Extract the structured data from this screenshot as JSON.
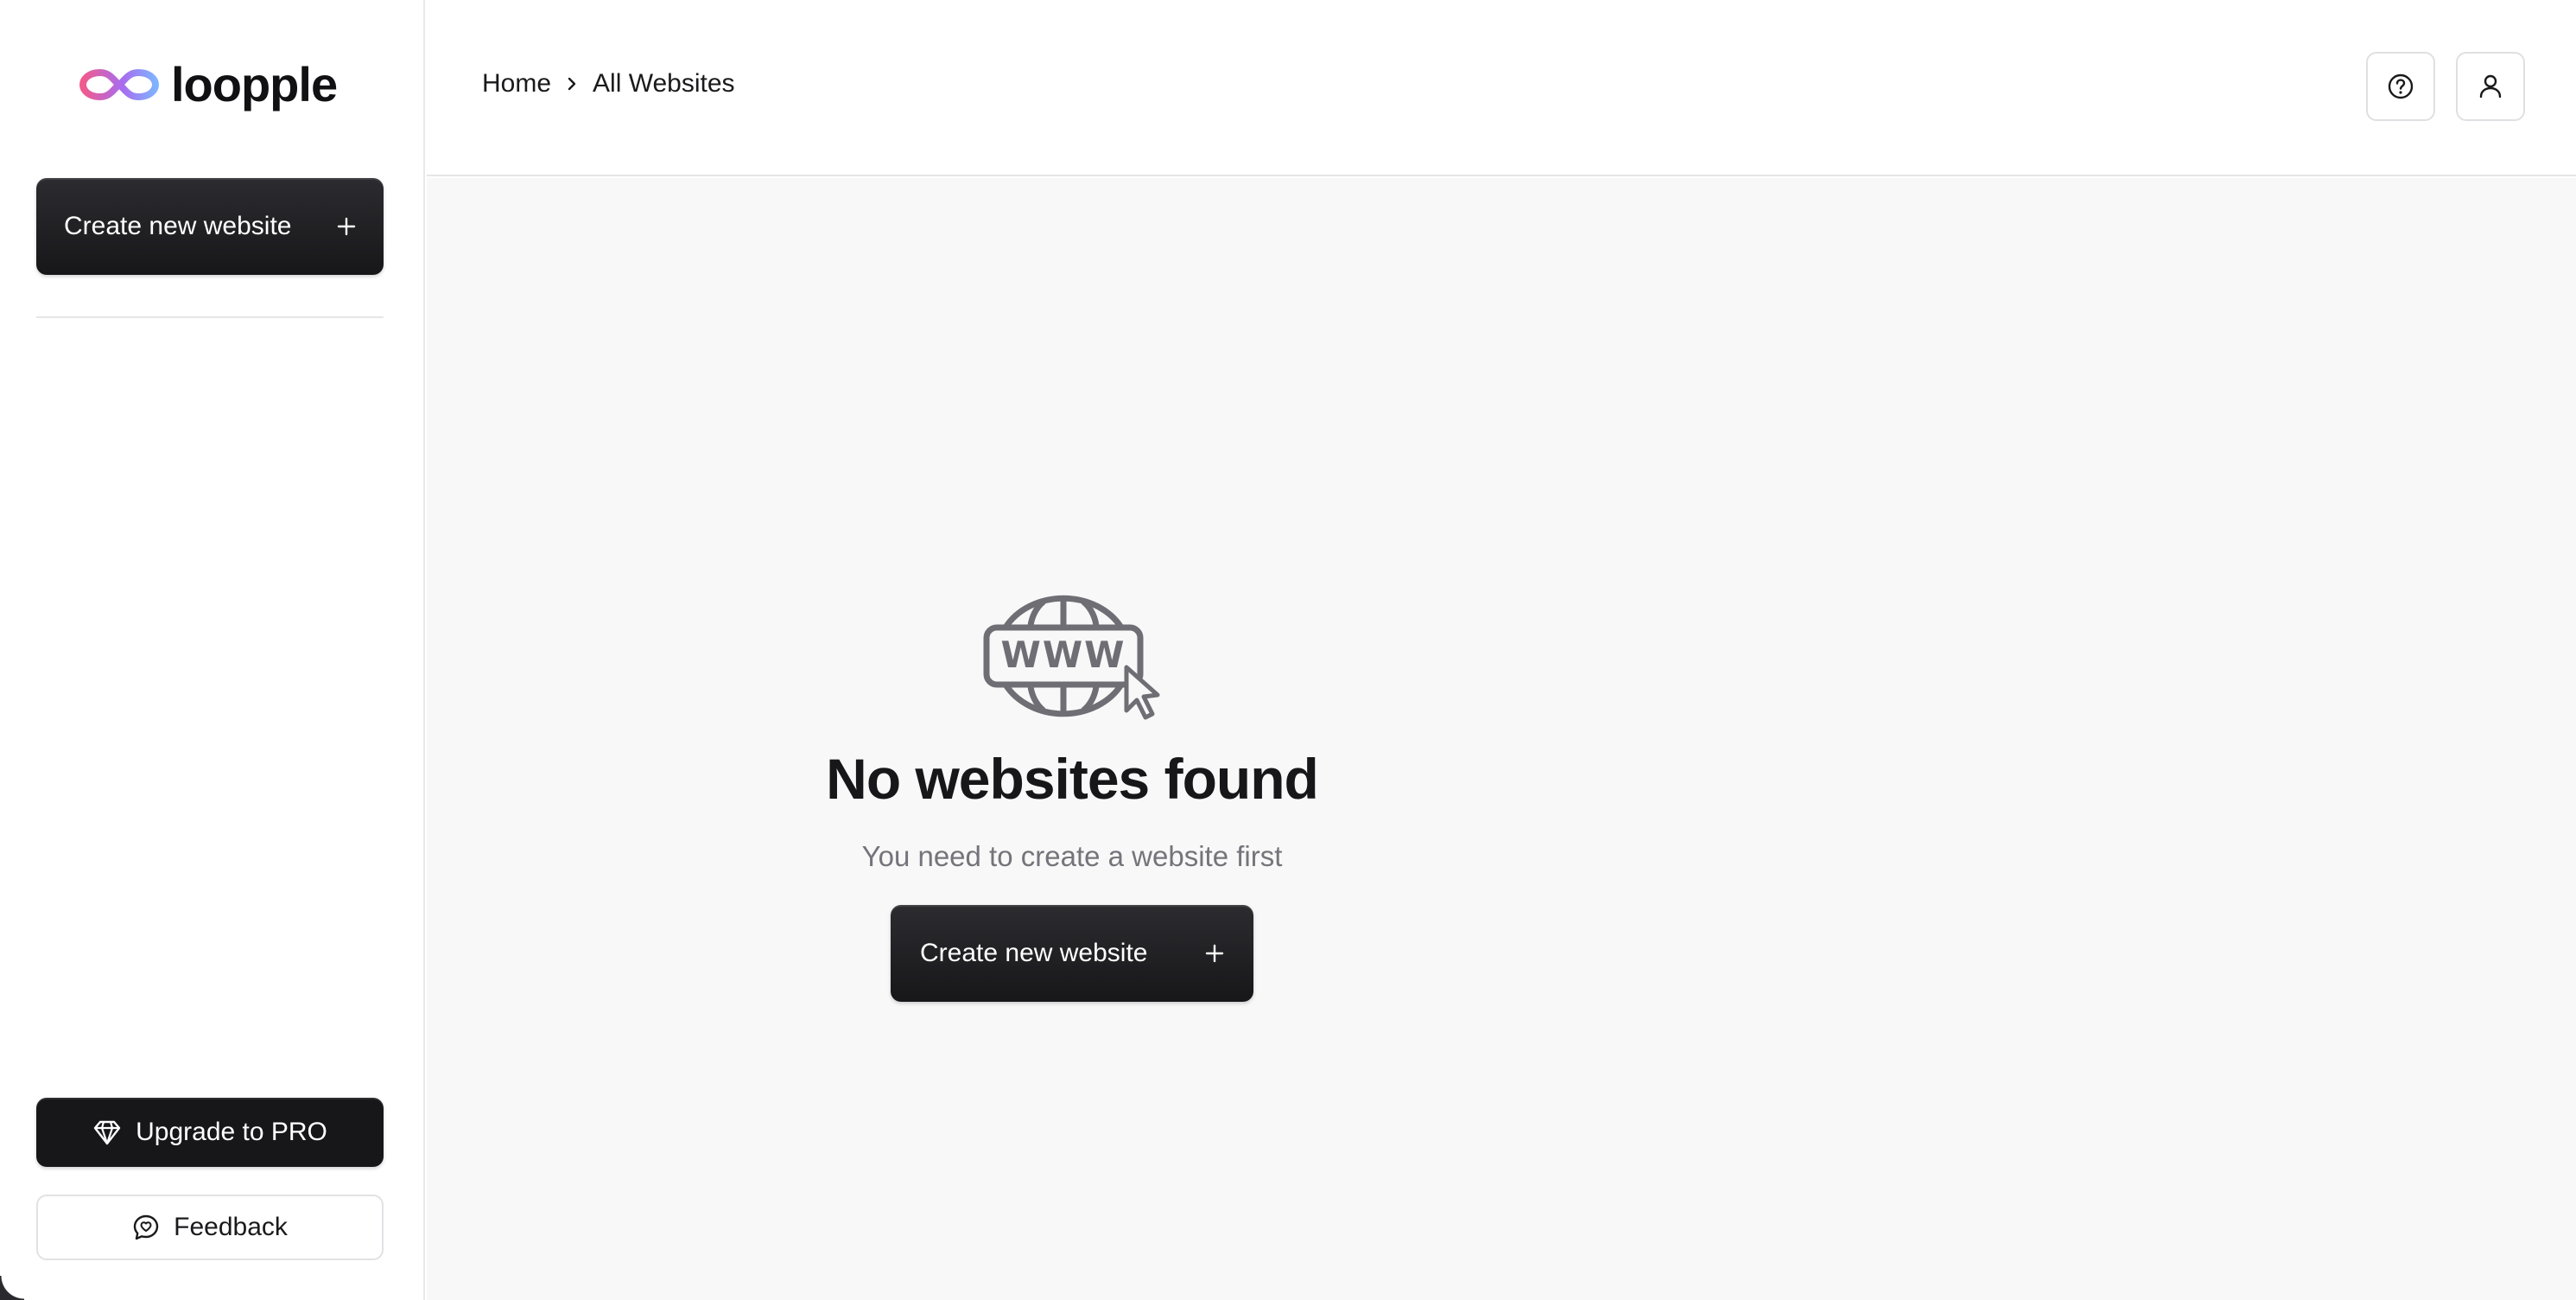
{
  "app": {
    "name": "loopple",
    "logo_name": "loopple"
  },
  "sidebar": {
    "create_label": "Create new website",
    "upgrade_label": "Upgrade to PRO",
    "feedback_label": "Feedback"
  },
  "header": {
    "breadcrumb": [
      "Home",
      "All Websites"
    ]
  },
  "main": {
    "empty_icon_text": "WWW",
    "empty_title": "No websites found",
    "empty_subtitle": "You need to create a website first",
    "create_label": "Create new website"
  },
  "colors": {
    "button_dark": "#17171a",
    "page_bg": "#f8f8f8",
    "muted_text": "#74747a",
    "logo_gradient": [
      "#f05a8c",
      "#a86cf0",
      "#7fb3ff"
    ]
  },
  "icons": [
    "infinity-logo-icon",
    "plus-icon",
    "gem-icon",
    "chat-icon",
    "chevron-right-icon",
    "help-icon",
    "user-icon",
    "www-globe-icon"
  ]
}
